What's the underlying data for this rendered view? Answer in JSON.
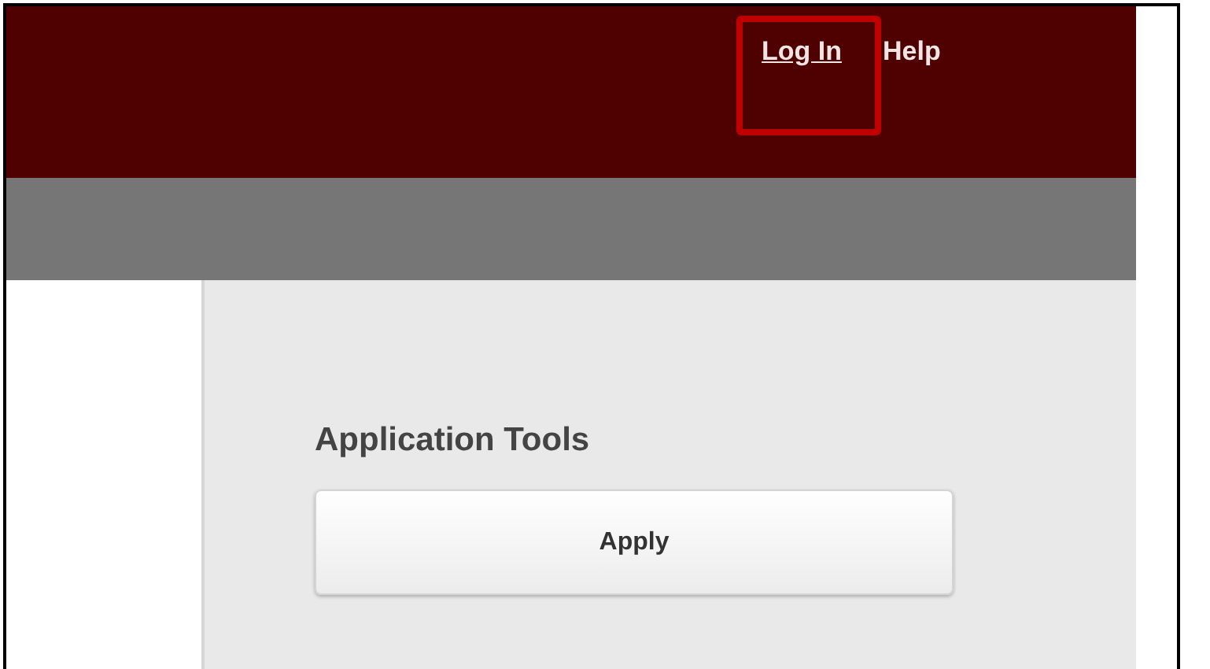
{
  "header": {
    "links": [
      {
        "label": "Log In",
        "underlined": true,
        "highlighted": true
      },
      {
        "label": "Help",
        "underlined": false,
        "highlighted": false
      }
    ]
  },
  "panel": {
    "heading": "Application Tools",
    "buttons": [
      "Apply"
    ]
  }
}
